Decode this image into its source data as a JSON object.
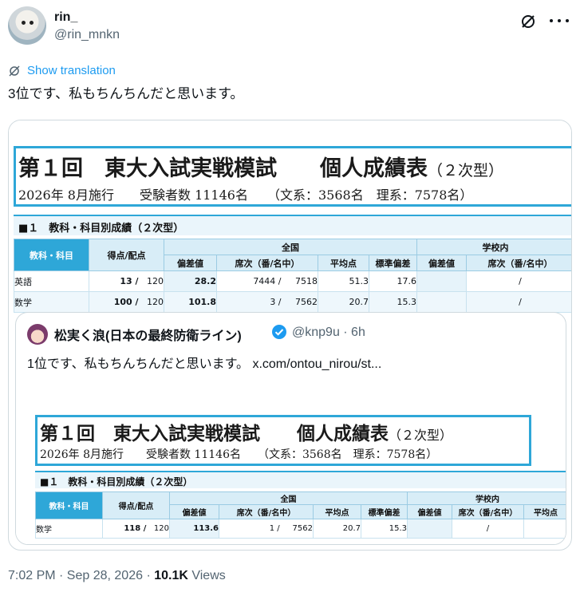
{
  "author": {
    "name": "rin_",
    "handle": "@rin_mnkn"
  },
  "translate_label": "Show translation",
  "tweet_text": "3位です、私もちんちんだと思います。",
  "report": {
    "title": "第１回　東大入試実戦模試　　個人成績表",
    "title_suffix": "（２次型）",
    "subtitle": "2026年 8月施行　　受験者数 11146名　　（文系：3568名　理系：7578名）",
    "section_label": "■１　教科・科目別成績（２次型）",
    "headers": {
      "subject": "教科・科目",
      "score": "得点/配点",
      "national": "全国",
      "school": "学校内",
      "deviation": "偏差値",
      "rank": "席次（番/名中）",
      "average": "平均点",
      "stddev": "標準偏差"
    }
  },
  "rows_main": [
    {
      "subject": "英語",
      "score": "13 /",
      "max": "120",
      "deviation": "28.2",
      "rank": "7444 /",
      "total": "7518",
      "average": "51.3",
      "stddev": "17.6",
      "school_rank": "/"
    },
    {
      "subject": "数学",
      "score": "100 /",
      "max": "120",
      "deviation": "101.8",
      "rank": "3 /",
      "total": "7562",
      "average": "20.7",
      "stddev": "15.3",
      "school_rank": "/"
    }
  ],
  "quote": {
    "name": "松実く浪(日本の最終防衛ライン)",
    "handle": "@knp9u · 6h",
    "text": "1位です、私もちんちんだと思います。 x.com/ontou_nirou/st...",
    "rows": [
      {
        "subject": "数学",
        "score": "118 /",
        "max": "120",
        "deviation": "113.6",
        "rank": "1 /",
        "total": "7562",
        "average": "20.7",
        "stddev": "15.3",
        "school_rank": "/"
      }
    ]
  },
  "footer": {
    "time": "7:02 PM · Sep 28, 2026 · ",
    "views_count": "10.1K",
    "views_label": " Views"
  },
  "colors": {
    "accent": "#1d9bf0",
    "report_blue": "#2ea7d8",
    "muted": "#536471"
  }
}
